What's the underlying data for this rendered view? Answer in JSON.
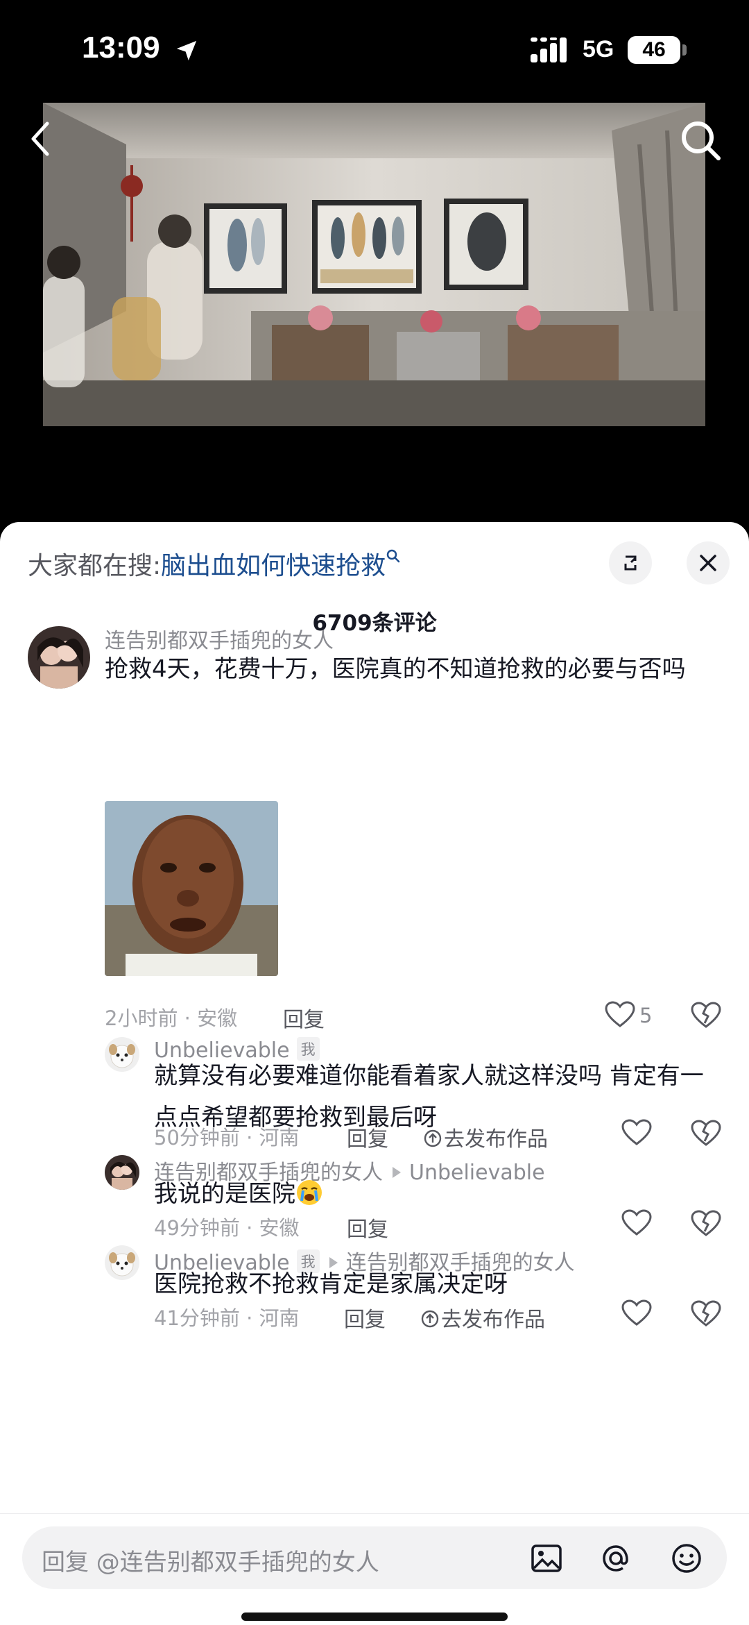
{
  "status_bar": {
    "time": "13:09",
    "network": "5G",
    "battery": "46"
  },
  "header": {
    "back_icon": "chevron-left-icon",
    "search_icon": "search-icon"
  },
  "panel": {
    "hot_search_prefix": "大家都在搜:",
    "hot_search_keyword": "脑出血如何快速抢救",
    "comment_count": "6709条评论"
  },
  "comments": {
    "main": {
      "username": "连告别都双手插兜的女人",
      "text": "抢救4天，花费十万，医院真的不知道抢救的必要与否吗",
      "meta": "2小时前 · 安徽",
      "reply": "回复",
      "likes": "5"
    },
    "reply1": {
      "username": "Unbelievable",
      "tag": "我",
      "text": "就算没有必要难道你能看着家人就这样没吗 肯定有一点点希望都要抢救到最后呀",
      "meta": "50分钟前 · 河南",
      "reply": "回复",
      "publish": "去发布作品"
    },
    "reply2": {
      "username": "连告别都双手插兜的女人",
      "reply_to": "Unbelievable",
      "text": "我说的是医院",
      "meta": "49分钟前 · 安徽",
      "reply": "回复"
    },
    "reply3": {
      "username": "Unbelievable",
      "tag": "我",
      "reply_to": "连告别都双手插兜的女人",
      "text": "医院抢救不抢救肯定是家属决定呀",
      "meta": "41分钟前 · 河南",
      "reply": "回复",
      "publish": "去发布作品"
    }
  },
  "input": {
    "placeholder": "回复 @连告别都双手插兜的女人"
  },
  "colors": {
    "keyword": "#1d4e8f",
    "panel_bg": "#ffffff",
    "text": "#161823",
    "muted": "#8a8b91"
  }
}
